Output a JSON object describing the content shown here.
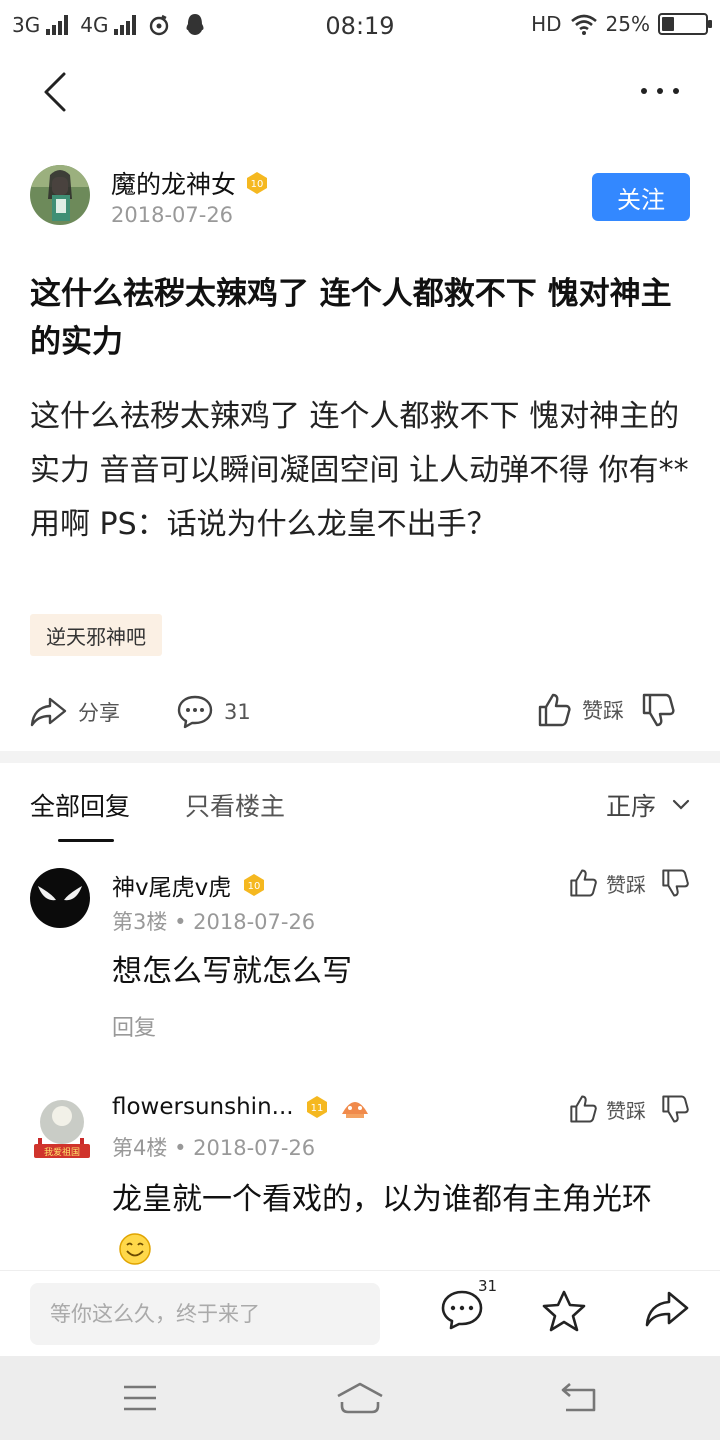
{
  "status_bar": {
    "sim1": "3G",
    "sim2": "4G",
    "time": "08:19",
    "hd": "HD",
    "battery": "25%",
    "battery_level": 0.25
  },
  "icons": {
    "back": "back-chevron-icon",
    "more": "more-dots-icon"
  },
  "post": {
    "author": "魔的龙神女",
    "author_level": "10",
    "date": "2018-07-26",
    "follow_label": "关注",
    "title": "这什么祛秽太辣鸡了  连个人都救不下  愧对神主的实力",
    "body": "这什么祛秽太辣鸡了 连个人都救不下 愧对神主的实力 音音可以瞬间凝固空间 让人动弹不得 你有**用啊 PS：话说为什么龙皇不出手？",
    "forum": "逆天邪神吧"
  },
  "actions": {
    "share": "分享",
    "comments": "31",
    "vote": "赞踩"
  },
  "tabs": {
    "all": "全部回复",
    "op_only": "只看楼主",
    "sort": "正序"
  },
  "replies": [
    {
      "name": "神v尾虎v虎",
      "level": "10",
      "floor": "第3楼",
      "date": "2018-07-26",
      "vote": "赞踩",
      "text": "想怎么写就怎么写",
      "reply_label": "回复"
    },
    {
      "name": "flowersunshin...",
      "level": "11",
      "floor": "第4楼",
      "date": "2018-07-26",
      "vote": "赞踩",
      "text": "龙皇就一个看戏的，以为谁都有主角光环",
      "avatar_text": "我爱祖国"
    }
  ],
  "bottom": {
    "placeholder": "等你这么久，终于来了",
    "comment_count": "31"
  },
  "colors": {
    "accent": "#3388ff",
    "tag_bg": "#fbf0e4",
    "badge_gold": "#f5b820"
  }
}
